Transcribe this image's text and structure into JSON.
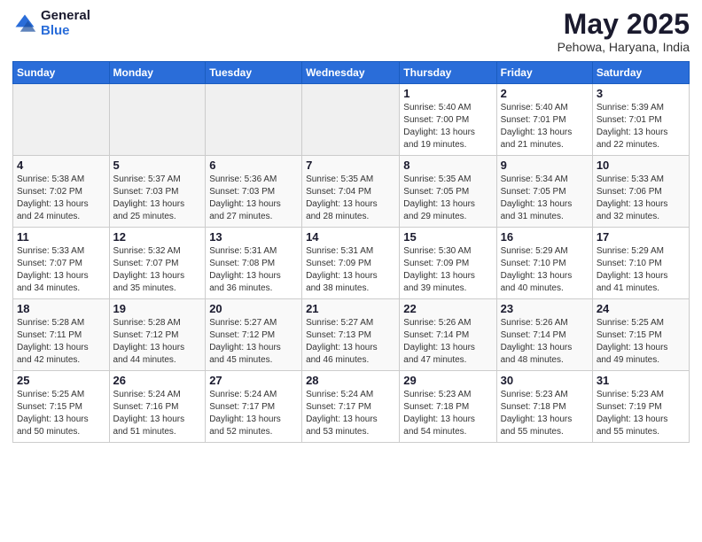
{
  "logo": {
    "general": "General",
    "blue": "Blue"
  },
  "header": {
    "title": "May 2025",
    "subtitle": "Pehowa, Haryana, India"
  },
  "weekdays": [
    "Sunday",
    "Monday",
    "Tuesday",
    "Wednesday",
    "Thursday",
    "Friday",
    "Saturday"
  ],
  "weeks": [
    [
      {
        "day": "",
        "info": ""
      },
      {
        "day": "",
        "info": ""
      },
      {
        "day": "",
        "info": ""
      },
      {
        "day": "",
        "info": ""
      },
      {
        "day": "1",
        "info": "Sunrise: 5:40 AM\nSunset: 7:00 PM\nDaylight: 13 hours\nand 19 minutes."
      },
      {
        "day": "2",
        "info": "Sunrise: 5:40 AM\nSunset: 7:01 PM\nDaylight: 13 hours\nand 21 minutes."
      },
      {
        "day": "3",
        "info": "Sunrise: 5:39 AM\nSunset: 7:01 PM\nDaylight: 13 hours\nand 22 minutes."
      }
    ],
    [
      {
        "day": "4",
        "info": "Sunrise: 5:38 AM\nSunset: 7:02 PM\nDaylight: 13 hours\nand 24 minutes."
      },
      {
        "day": "5",
        "info": "Sunrise: 5:37 AM\nSunset: 7:03 PM\nDaylight: 13 hours\nand 25 minutes."
      },
      {
        "day": "6",
        "info": "Sunrise: 5:36 AM\nSunset: 7:03 PM\nDaylight: 13 hours\nand 27 minutes."
      },
      {
        "day": "7",
        "info": "Sunrise: 5:35 AM\nSunset: 7:04 PM\nDaylight: 13 hours\nand 28 minutes."
      },
      {
        "day": "8",
        "info": "Sunrise: 5:35 AM\nSunset: 7:05 PM\nDaylight: 13 hours\nand 29 minutes."
      },
      {
        "day": "9",
        "info": "Sunrise: 5:34 AM\nSunset: 7:05 PM\nDaylight: 13 hours\nand 31 minutes."
      },
      {
        "day": "10",
        "info": "Sunrise: 5:33 AM\nSunset: 7:06 PM\nDaylight: 13 hours\nand 32 minutes."
      }
    ],
    [
      {
        "day": "11",
        "info": "Sunrise: 5:33 AM\nSunset: 7:07 PM\nDaylight: 13 hours\nand 34 minutes."
      },
      {
        "day": "12",
        "info": "Sunrise: 5:32 AM\nSunset: 7:07 PM\nDaylight: 13 hours\nand 35 minutes."
      },
      {
        "day": "13",
        "info": "Sunrise: 5:31 AM\nSunset: 7:08 PM\nDaylight: 13 hours\nand 36 minutes."
      },
      {
        "day": "14",
        "info": "Sunrise: 5:31 AM\nSunset: 7:09 PM\nDaylight: 13 hours\nand 38 minutes."
      },
      {
        "day": "15",
        "info": "Sunrise: 5:30 AM\nSunset: 7:09 PM\nDaylight: 13 hours\nand 39 minutes."
      },
      {
        "day": "16",
        "info": "Sunrise: 5:29 AM\nSunset: 7:10 PM\nDaylight: 13 hours\nand 40 minutes."
      },
      {
        "day": "17",
        "info": "Sunrise: 5:29 AM\nSunset: 7:10 PM\nDaylight: 13 hours\nand 41 minutes."
      }
    ],
    [
      {
        "day": "18",
        "info": "Sunrise: 5:28 AM\nSunset: 7:11 PM\nDaylight: 13 hours\nand 42 minutes."
      },
      {
        "day": "19",
        "info": "Sunrise: 5:28 AM\nSunset: 7:12 PM\nDaylight: 13 hours\nand 44 minutes."
      },
      {
        "day": "20",
        "info": "Sunrise: 5:27 AM\nSunset: 7:12 PM\nDaylight: 13 hours\nand 45 minutes."
      },
      {
        "day": "21",
        "info": "Sunrise: 5:27 AM\nSunset: 7:13 PM\nDaylight: 13 hours\nand 46 minutes."
      },
      {
        "day": "22",
        "info": "Sunrise: 5:26 AM\nSunset: 7:14 PM\nDaylight: 13 hours\nand 47 minutes."
      },
      {
        "day": "23",
        "info": "Sunrise: 5:26 AM\nSunset: 7:14 PM\nDaylight: 13 hours\nand 48 minutes."
      },
      {
        "day": "24",
        "info": "Sunrise: 5:25 AM\nSunset: 7:15 PM\nDaylight: 13 hours\nand 49 minutes."
      }
    ],
    [
      {
        "day": "25",
        "info": "Sunrise: 5:25 AM\nSunset: 7:15 PM\nDaylight: 13 hours\nand 50 minutes."
      },
      {
        "day": "26",
        "info": "Sunrise: 5:24 AM\nSunset: 7:16 PM\nDaylight: 13 hours\nand 51 minutes."
      },
      {
        "day": "27",
        "info": "Sunrise: 5:24 AM\nSunset: 7:17 PM\nDaylight: 13 hours\nand 52 minutes."
      },
      {
        "day": "28",
        "info": "Sunrise: 5:24 AM\nSunset: 7:17 PM\nDaylight: 13 hours\nand 53 minutes."
      },
      {
        "day": "29",
        "info": "Sunrise: 5:23 AM\nSunset: 7:18 PM\nDaylight: 13 hours\nand 54 minutes."
      },
      {
        "day": "30",
        "info": "Sunrise: 5:23 AM\nSunset: 7:18 PM\nDaylight: 13 hours\nand 55 minutes."
      },
      {
        "day": "31",
        "info": "Sunrise: 5:23 AM\nSunset: 7:19 PM\nDaylight: 13 hours\nand 55 minutes."
      }
    ]
  ]
}
